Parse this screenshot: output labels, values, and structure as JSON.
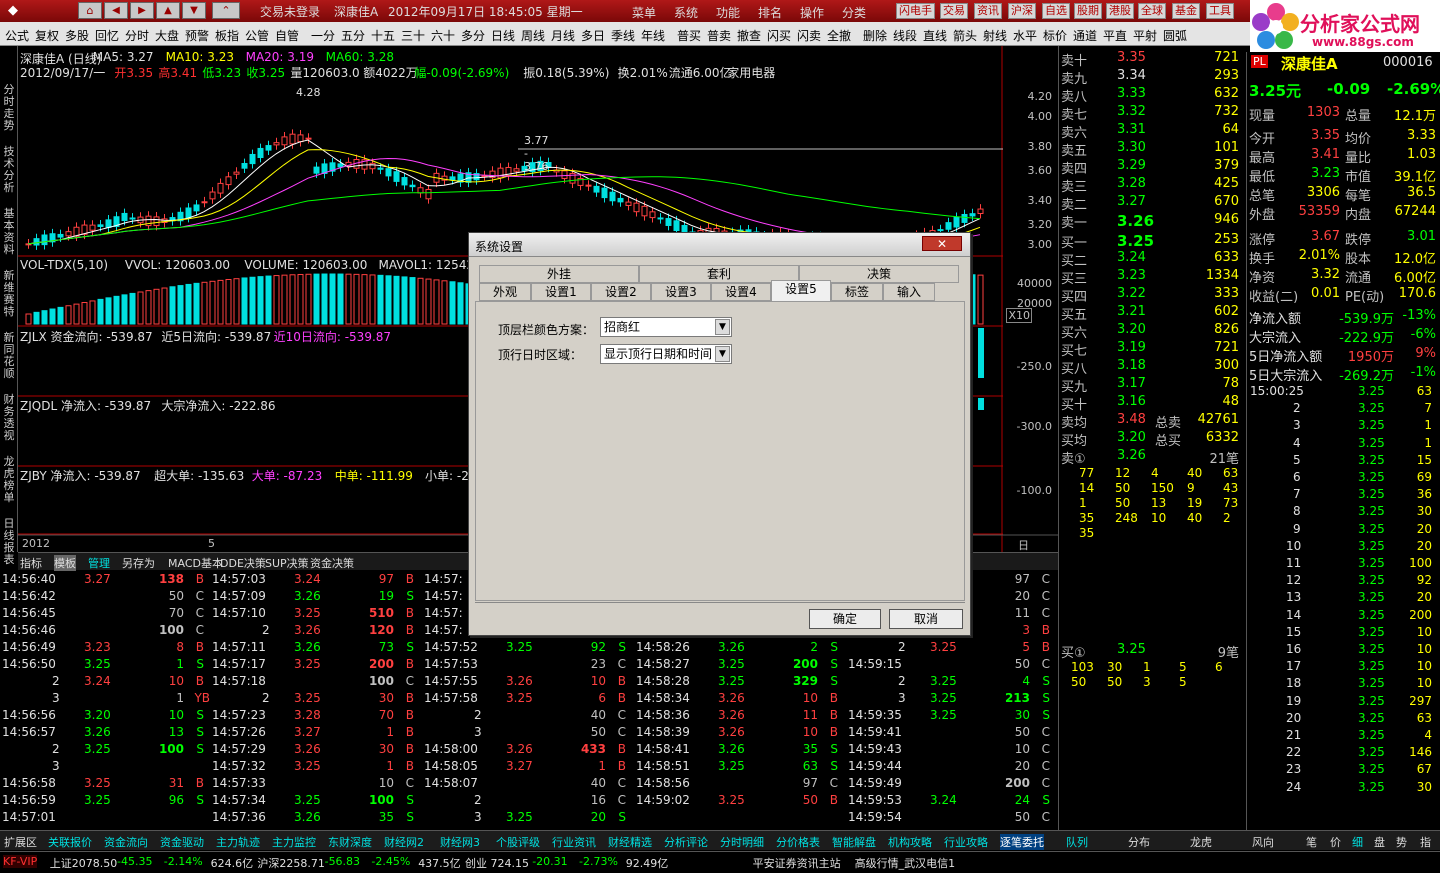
{
  "titlebar": {
    "trade_login": "交易未登录",
    "stock_name": "深康佳A",
    "datetime": "2012年09月17日 18:45:05 星期一"
  },
  "menu": [
    "菜单",
    "系统",
    "功能",
    "排名",
    "操作",
    "分类"
  ],
  "quick_buttons": [
    "闪电手",
    "交易",
    "资讯",
    "沪深",
    "自选",
    "股期",
    "港股",
    "全球",
    "基金",
    "工具"
  ],
  "logo": {
    "text": "分析家公式网",
    "url_text": "www.88gs.com"
  },
  "toolbar": [
    "公式",
    "复权",
    "多股",
    "回忆",
    "分时",
    "大盘",
    "预警",
    "板指",
    "公管",
    "自管",
    "一分",
    "五分",
    "十五",
    "三十",
    "六十",
    "多分",
    "日线",
    "周线",
    "月线",
    "多日",
    "季线",
    "年线",
    "普买",
    "普卖",
    "撤查",
    "闪买",
    "闪卖",
    "全撤",
    "删除",
    "线段",
    "直线",
    "箭头",
    "射线",
    "水平",
    "标价",
    "通道",
    "平直",
    "平射",
    "圆弧"
  ],
  "side_tabs": [
    "分时走势",
    "技术分析",
    "基本资料",
    "新维赛特",
    "新同花顺",
    "财务透视",
    "龙虎榜单",
    "日线报表"
  ],
  "chart": {
    "line1": [
      {
        "t": "深康佳A (日线)",
        "c": "white"
      },
      {
        "t": "MA5: 3.27",
        "c": "white"
      },
      {
        "t": "MA10: 3.23",
        "c": "yellow"
      },
      {
        "t": "MA20: 3.19",
        "c": "magenta"
      },
      {
        "t": "MA60: 3.28",
        "c": "green"
      }
    ],
    "line2": [
      {
        "t": "2012/09/17/一",
        "c": "white"
      },
      {
        "t": "开3.35",
        "c": "red"
      },
      {
        "t": "高3.41",
        "c": "red"
      },
      {
        "t": "低3.23",
        "c": "green"
      },
      {
        "t": "收3.25",
        "c": "green"
      },
      {
        "t": "量120603.0",
        "c": "white"
      },
      {
        "t": "额4022万",
        "c": "white"
      },
      {
        "t": "幅-0.09(-2.69%)",
        "c": "green"
      },
      {
        "t": "振0.18(5.39%)",
        "c": "white"
      },
      {
        "t": "换2.01%",
        "c": "white"
      },
      {
        "t": "流通6.00亿",
        "c": "white"
      },
      {
        "t": "家用电器",
        "c": "white"
      }
    ],
    "peak_label": "4.28",
    "flat_label": "3.77 - 3.76",
    "price_axis": [
      "4.20",
      "4.00",
      "3.80",
      "3.60",
      "3.40",
      "3.20",
      "3.00"
    ],
    "vol_title": [
      {
        "t": "VOL-TDX(5,10)",
        "c": "white"
      },
      {
        "t": "VVOL: 120603.00",
        "c": "white"
      },
      {
        "t": "VOLUME: 120603.00",
        "c": "white"
      },
      {
        "t": "MAVOL1: 125428.40",
        "c": "white"
      }
    ],
    "vol_axis": [
      "40000",
      "20000",
      "X10"
    ],
    "zjlx": [
      {
        "t": "ZJLX 资金流向: -539.87",
        "c": "white"
      },
      {
        "t": "近5日流向: -539.87",
        "c": "white"
      },
      {
        "t": "近10日流向: -539.87",
        "c": "magenta"
      }
    ],
    "zjqdl": [
      {
        "t": "ZJQDL 净流入: -539.87",
        "c": "white"
      },
      {
        "t": "大宗净流入: -222.86",
        "c": "white"
      }
    ],
    "zjby": [
      {
        "t": "ZJBY 净流入: -539.87",
        "c": "white"
      },
      {
        "t": "超大单: -135.63",
        "c": "white"
      },
      {
        "t": "大单: -87.23",
        "c": "magenta"
      },
      {
        "t": "中单: -111.99",
        "c": "yellow"
      },
      {
        "t": "小单: -20",
        "c": "white"
      }
    ],
    "flow_axis": [
      "-250.0",
      "-300.0",
      "-100.0"
    ],
    "date_axis": [
      "2012年",
      "5",
      "日线"
    ]
  },
  "bottom_tabs": [
    "指标",
    "模板",
    "管理",
    "另存为",
    "MACD基本",
    "DDE决策",
    "SUP决策",
    "资金决策"
  ],
  "trades": [
    [
      [
        "14:56:40",
        "3.27",
        "138",
        "B"
      ],
      [
        "14:56:42",
        "",
        "50",
        "C"
      ],
      [
        "14:56:45",
        "",
        "70",
        "C"
      ],
      [
        "14:56:46",
        "",
        "100",
        "C"
      ],
      [
        "14:56:49",
        "3.23",
        "8",
        "B"
      ],
      [
        "14:56:50",
        "3.25",
        "1",
        "S"
      ],
      [
        "2",
        "3.24",
        "10",
        "B"
      ],
      [
        "3",
        "",
        "1",
        "YB"
      ],
      [
        "14:56:56",
        "3.20",
        "10",
        "S"
      ],
      [
        "14:56:57",
        "3.26",
        "13",
        "S"
      ],
      [
        "2",
        "3.25",
        "100",
        "S"
      ],
      [
        "3",
        "",
        "",
        ""
      ],
      [
        "14:56:58",
        "3.25",
        "31",
        "B"
      ],
      [
        "14:56:59",
        "3.25",
        "96",
        "S"
      ],
      [
        "14:57:01",
        "",
        "",
        ""
      ]
    ],
    [
      [
        "14:57:03",
        "3.24",
        "97",
        "B"
      ],
      [
        "14:57:09",
        "3.26",
        "19",
        "S"
      ],
      [
        "14:57:10",
        "3.25",
        "510",
        "B"
      ],
      [
        "2",
        "3.26",
        "120",
        "B"
      ],
      [
        "14:57:11",
        "3.26",
        "73",
        "S"
      ],
      [
        "14:57:17",
        "3.25",
        "200",
        "B"
      ],
      [
        "14:57:18",
        "",
        "100",
        "C"
      ],
      [
        "2",
        "3.25",
        "30",
        "B"
      ],
      [
        "14:57:23",
        "3.28",
        "70",
        "B"
      ],
      [
        "14:57:26",
        "3.27",
        "1",
        "B"
      ],
      [
        "14:57:29",
        "3.26",
        "30",
        "B"
      ],
      [
        "14:57:32",
        "3.25",
        "1",
        "B"
      ],
      [
        "14:57:33",
        "",
        "10",
        "C"
      ],
      [
        "14:57:34",
        "3.25",
        "100",
        "S"
      ],
      [
        "14:57:36",
        "3.26",
        "35",
        "S"
      ]
    ],
    [
      [
        "14:57:",
        "",
        "",
        ""
      ],
      [
        "14:57:",
        "",
        "",
        ""
      ],
      [
        "14:57:",
        "",
        "",
        ""
      ],
      [
        "14:57:",
        "",
        "",
        ""
      ],
      [
        "14:57:52",
        "3.25",
        "92",
        "S"
      ],
      [
        "14:57:53",
        "",
        "23",
        "C"
      ],
      [
        "14:57:55",
        "3.26",
        "10",
        "B"
      ],
      [
        "14:57:58",
        "3.25",
        "6",
        "B"
      ],
      [
        "2",
        "",
        "40",
        "C"
      ],
      [
        "3",
        "",
        "50",
        "C"
      ],
      [
        "14:58:00",
        "3.26",
        "433",
        "B"
      ],
      [
        "14:58:05",
        "3.27",
        "1",
        "B"
      ],
      [
        "14:58:07",
        "",
        "40",
        "C"
      ],
      [
        "2",
        "",
        "16",
        "C"
      ],
      [
        "3",
        "3.25",
        "20",
        "S"
      ]
    ],
    [
      [
        "",
        "",
        "",
        ""
      ],
      [
        "",
        "",
        "",
        ""
      ],
      [
        "",
        "",
        "",
        ""
      ],
      [
        "",
        "",
        "",
        ""
      ],
      [
        "14:58:26",
        "3.26",
        "2",
        "S"
      ],
      [
        "14:58:27",
        "3.25",
        "200",
        "S"
      ],
      [
        "14:58:28",
        "3.25",
        "329",
        "S"
      ],
      [
        "14:58:34",
        "3.26",
        "10",
        "B"
      ],
      [
        "14:58:36",
        "3.26",
        "11",
        "B"
      ],
      [
        "14:58:39",
        "3.26",
        "10",
        "B"
      ],
      [
        "14:58:41",
        "3.26",
        "35",
        "S"
      ],
      [
        "14:58:51",
        "3.25",
        "63",
        "S"
      ],
      [
        "14:58:56",
        "",
        "97",
        "C"
      ],
      [
        "14:59:02",
        "3.25",
        "50",
        "B"
      ],
      [
        "",
        "",
        "",
        ""
      ]
    ],
    [
      [
        "",
        "",
        "97",
        "C"
      ],
      [
        "",
        "",
        "20",
        "C"
      ],
      [
        "",
        "",
        "11",
        "C"
      ],
      [
        "",
        "",
        "3",
        "B"
      ],
      [
        "2",
        "3.25",
        "5",
        "B"
      ],
      [
        "14:59:15",
        "",
        "50",
        "C"
      ],
      [
        "2",
        "3.25",
        "4",
        "S"
      ],
      [
        "3",
        "3.25",
        "213",
        "S"
      ],
      [
        "14:59:35",
        "3.25",
        "30",
        "S"
      ],
      [
        "14:59:41",
        "",
        "50",
        "C"
      ],
      [
        "14:59:43",
        "",
        "10",
        "C"
      ],
      [
        "14:59:44",
        "",
        "20",
        "C"
      ],
      [
        "14:59:49",
        "",
        "200",
        "C"
      ],
      [
        "14:59:53",
        "3.24",
        "24",
        "S"
      ],
      [
        "14:59:54",
        "",
        "50",
        "C"
      ]
    ]
  ],
  "bottom_bar": [
    "扩展区",
    "关联报价",
    "资金流向",
    "资金驱动",
    "主力轨迹",
    "主力监控",
    "东财深度",
    "财经网2",
    "财经网3",
    "个股评级",
    "行业资讯",
    "财经精选",
    "分析评论",
    "分时明细",
    "分价格表",
    "智能解盘",
    "机构攻略",
    "行业攻略",
    "逐笔委托"
  ],
  "right_tabs": [
    "队列",
    "分布",
    "龙虎",
    "风向",
    "笔",
    "价",
    "细",
    "盘",
    "势",
    "指",
    "值"
  ],
  "status": [
    {
      "t": "KF-VIP",
      "c": "red"
    },
    {
      "t": "上证2078.50",
      "c": "white"
    },
    {
      "t": "-45.35",
      "c": "green"
    },
    {
      "t": "-2.14%",
      "c": "green"
    },
    {
      "t": "624.6亿",
      "c": "white"
    },
    {
      "t": "沪深2258.71",
      "c": "white"
    },
    {
      "t": "-56.83",
      "c": "green"
    },
    {
      "t": "-2.45%",
      "c": "green"
    },
    {
      "t": "437.5亿",
      "c": "white"
    },
    {
      "t": "创业 724.15",
      "c": "white"
    },
    {
      "t": "-20.31",
      "c": "green"
    },
    {
      "t": "-2.73%",
      "c": "green"
    },
    {
      "t": "92.49亿",
      "c": "white"
    },
    {
      "t": "平安证券资讯主站",
      "c": "white"
    },
    {
      "t": "高级行情_武汉电信1",
      "c": "white"
    }
  ],
  "orderbook": {
    "sells": [
      [
        "卖十",
        "3.35",
        "721"
      ],
      [
        "卖九",
        "3.34",
        "293"
      ],
      [
        "卖八",
        "3.33",
        "632"
      ],
      [
        "卖七",
        "3.32",
        "732"
      ],
      [
        "卖六",
        "3.31",
        "64"
      ],
      [
        "卖五",
        "3.30",
        "101"
      ],
      [
        "卖四",
        "3.29",
        "379"
      ],
      [
        "卖三",
        "3.28",
        "425"
      ],
      [
        "卖二",
        "3.27",
        "670"
      ],
      [
        "卖一",
        "3.26",
        "946"
      ]
    ],
    "buys": [
      [
        "买一",
        "3.25",
        "253"
      ],
      [
        "买二",
        "3.24",
        "633"
      ],
      [
        "买三",
        "3.23",
        "1334"
      ],
      [
        "买四",
        "3.22",
        "333"
      ],
      [
        "买五",
        "3.21",
        "602"
      ],
      [
        "买六",
        "3.20",
        "826"
      ],
      [
        "买七",
        "3.19",
        "721"
      ],
      [
        "买八",
        "3.18",
        "300"
      ],
      [
        "买九",
        "3.17",
        "78"
      ],
      [
        "买十",
        "3.16",
        "48"
      ]
    ],
    "avg_sell": [
      "卖均",
      "3.48",
      "总卖",
      "42761"
    ],
    "avg_buy": [
      "买均",
      "3.20",
      "总买",
      "6332"
    ],
    "sell1_queue_head": [
      "卖①",
      "3.26",
      "21笔"
    ],
    "sell1_queue": [
      [
        "77",
        "12",
        "4",
        "40",
        "63"
      ],
      [
        "14",
        "50",
        "150",
        "9",
        "43"
      ],
      [
        "1",
        "50",
        "13",
        "19",
        "73"
      ],
      [
        "35",
        "248",
        "10",
        "40",
        "2"
      ],
      [
        "35",
        "",
        "",
        "",
        ""
      ]
    ],
    "buy1_queue_head": [
      "买①",
      "3.25",
      "9笔"
    ],
    "buy1_queue": [
      [
        "103",
        "30",
        "1",
        "5",
        "6"
      ],
      [
        "50",
        "50",
        "3",
        "5",
        ""
      ]
    ]
  },
  "quote": {
    "tag": "PL",
    "name": "深康佳A",
    "code": "000016",
    "price": "3.25元",
    "change": "-0.09",
    "pct": "-2.69%",
    "rows": [
      [
        [
          "现量",
          "1303"
        ],
        [
          "总量",
          "12.1万"
        ]
      ],
      [
        [
          "今开",
          "3.35"
        ],
        [
          "均价",
          "3.33"
        ]
      ],
      [
        [
          "最高",
          "3.41"
        ],
        [
          "量比",
          "1.03"
        ]
      ],
      [
        [
          "最低",
          "3.23"
        ],
        [
          "市值",
          "39.1亿"
        ]
      ],
      [
        [
          "总笔",
          "3306"
        ],
        [
          "每笔",
          "36.5"
        ]
      ],
      [
        [
          "外盘",
          "53359"
        ],
        [
          "内盘",
          "67244"
        ]
      ],
      [
        [
          "涨停",
          "3.67"
        ],
        [
          "跌停",
          "3.01"
        ]
      ],
      [
        [
          "换手",
          "2.01%"
        ],
        [
          "股本",
          "12.0亿"
        ]
      ],
      [
        [
          "净资",
          "3.32"
        ],
        [
          "流通",
          "6.00亿"
        ]
      ],
      [
        [
          "收益(二)",
          "0.01"
        ],
        [
          "PE(动)",
          "170.6"
        ]
      ]
    ],
    "flows": [
      [
        "净流入额",
        "-539.9万",
        "-13%"
      ],
      [
        "大宗流入",
        "-222.9万",
        "-6%"
      ],
      [
        "5日净流入额",
        "1950万",
        "9%"
      ],
      [
        "5日大宗流入",
        "-269.2万",
        "-1%"
      ]
    ]
  },
  "ticks": [
    [
      "15:00:25",
      "3.25",
      "63"
    ],
    [
      "2",
      "3.25",
      "7"
    ],
    [
      "3",
      "3.25",
      "1"
    ],
    [
      "4",
      "3.25",
      "1"
    ],
    [
      "5",
      "3.25",
      "15"
    ],
    [
      "6",
      "3.25",
      "69"
    ],
    [
      "7",
      "3.25",
      "36"
    ],
    [
      "8",
      "3.25",
      "30"
    ],
    [
      "9",
      "3.25",
      "20"
    ],
    [
      "10",
      "3.25",
      "20"
    ],
    [
      "11",
      "3.25",
      "100"
    ],
    [
      "12",
      "3.25",
      "92"
    ],
    [
      "13",
      "3.25",
      "20"
    ],
    [
      "14",
      "3.25",
      "200"
    ],
    [
      "15",
      "3.25",
      "10"
    ],
    [
      "16",
      "3.25",
      "10"
    ],
    [
      "17",
      "3.25",
      "10"
    ],
    [
      "18",
      "3.25",
      "10"
    ],
    [
      "19",
      "3.25",
      "297"
    ],
    [
      "20",
      "3.25",
      "63"
    ],
    [
      "21",
      "3.25",
      "4"
    ],
    [
      "22",
      "3.25",
      "146"
    ],
    [
      "23",
      "3.25",
      "67"
    ],
    [
      "24",
      "3.25",
      "30"
    ]
  ],
  "dialog": {
    "title": "系统设置",
    "close": "✕",
    "tabs_top": [
      "外挂",
      "套利",
      "决策"
    ],
    "tabs_bottom": [
      "外观",
      "设置1",
      "设置2",
      "设置3",
      "设置4",
      "设置5",
      "标签",
      "输入"
    ],
    "active_tab": "设置5",
    "field1_label": "顶层栏颜色方案：",
    "field1_value": "招商红",
    "field2_label": "顶行日时区域：",
    "field2_value": "显示顶行日期和时间",
    "ok": "确定",
    "cancel": "取消"
  }
}
